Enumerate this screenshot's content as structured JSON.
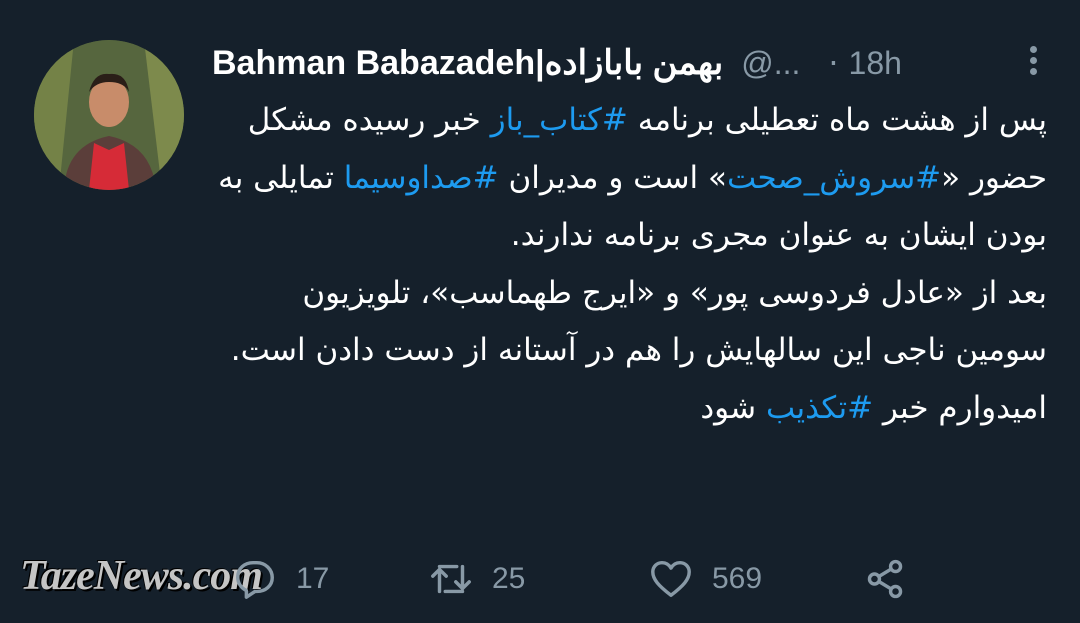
{
  "tweet": {
    "author_name": "Bahman Babazadeh|بهمن بابازاده",
    "handle": "@...",
    "separator": "·",
    "time": "18h",
    "paragraphs": [
      [
        {
          "t": "پس از هشت ماه تعطیلی برنامه ",
          "tag": false
        },
        {
          "t": "#کتاب_باز",
          "tag": true
        },
        {
          "t": " خبر رسیده مشکل حضور «",
          "tag": false
        },
        {
          "t": "#سروش_صحت",
          "tag": true
        },
        {
          "t": "» است و مدیران ",
          "tag": false
        },
        {
          "t": "#صداوسیما",
          "tag": true
        },
        {
          "t": " تمایلی به بودن ایشان به عنوان مجری برنامه ندارند.",
          "tag": false
        }
      ],
      [
        {
          "t": "بعد از «عادل فردوسی پور» و «ایرج طهماسب»، تلویزیون سومین ناجی این سالهایش را هم در آستانه از دست دادن است.",
          "tag": false
        }
      ],
      [
        {
          "t": "امیدوارم خبر ",
          "tag": false
        },
        {
          "t": "#تکذیب",
          "tag": true
        },
        {
          "t": " شود",
          "tag": false
        }
      ]
    ]
  },
  "actions": {
    "reply_count": "17",
    "retweet_count": "25",
    "like_count": "569"
  },
  "watermark": "TazeNews.com",
  "icons": {
    "avatar": "avatar-photo",
    "more": "more-vertical-icon",
    "reply": "reply-icon",
    "retweet": "retweet-icon",
    "like": "heart-icon",
    "share": "share-icon"
  },
  "colors": {
    "background": "#15202b",
    "hashtag": "#1d9bf0",
    "secondary": "#8899a6"
  }
}
